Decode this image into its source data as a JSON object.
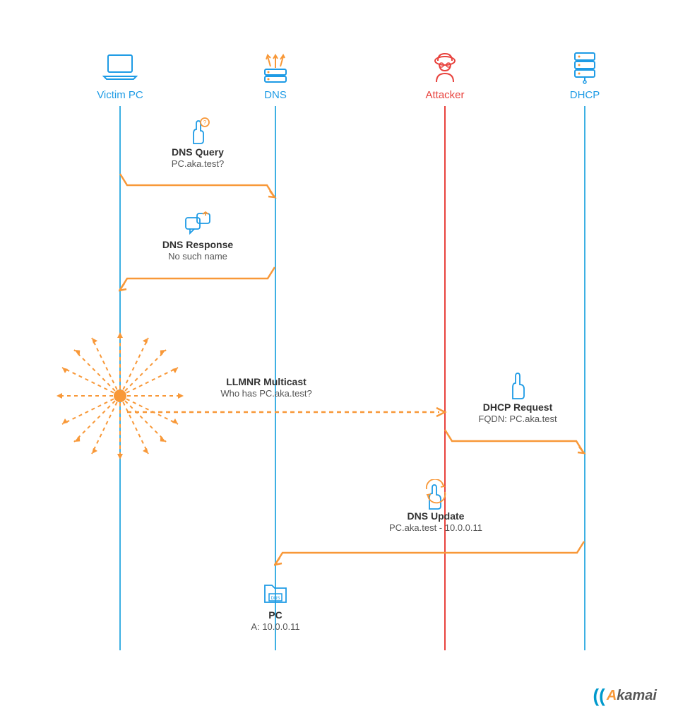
{
  "actors": {
    "victim": {
      "label": "Victim PC"
    },
    "dns": {
      "label": "DNS"
    },
    "attacker": {
      "label": "Attacker"
    },
    "dhcp": {
      "label": "DHCP"
    }
  },
  "messages": {
    "dns_query": {
      "title": "DNS Query",
      "sub": "PC.aka.test?"
    },
    "dns_response": {
      "title": "DNS Response",
      "sub": "No such name"
    },
    "llmnr": {
      "title": "LLMNR Multicast",
      "sub": "Who has PC.aka.test?"
    },
    "dhcp_req": {
      "title": "DHCP Request",
      "sub": "FQDN: PC.aka.test"
    },
    "dns_update": {
      "title": "DNS Update",
      "sub": "PC.aka.test - 10.0.0.11"
    },
    "dns_record": {
      "title": "PC",
      "sub": "A: 10.0.0.11"
    }
  },
  "brand": {
    "name": "Akamai"
  },
  "colors": {
    "blue": "#1e9be5",
    "red": "#e8423d",
    "orange": "#f89838"
  }
}
